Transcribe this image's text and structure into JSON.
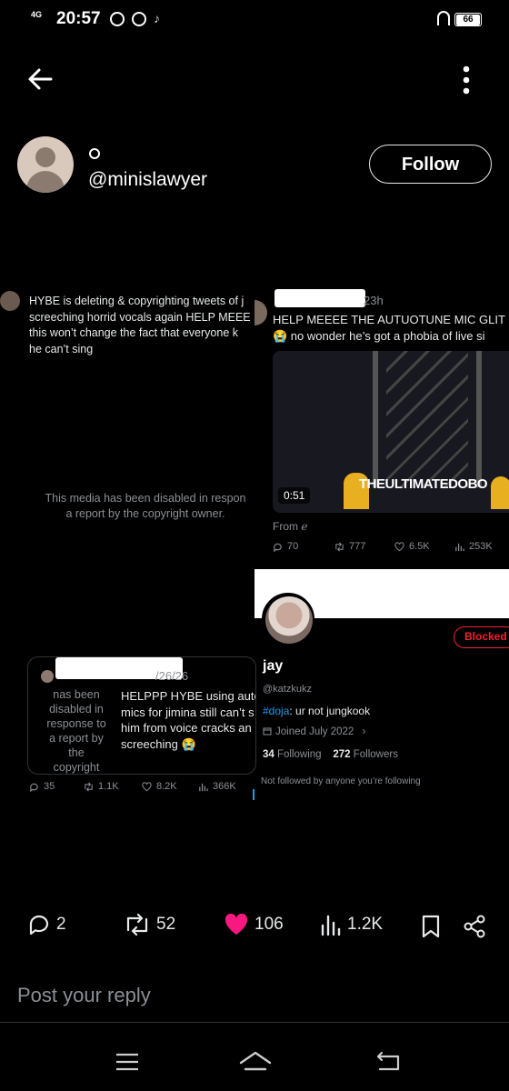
{
  "status_bar": {
    "network": "4G",
    "time": "20:57",
    "battery": "66"
  },
  "profile": {
    "handle": "@minislawyer",
    "follow_label": "Follow"
  },
  "embedded": {
    "tweet1": {
      "lines": [
        "HYBE is deleting & copyrighting tweets of j",
        "screeching horrid vocals again HELP MEEE",
        "this won’t change the fact that everyone k",
        "he can’t sing"
      ],
      "disabled_notice": [
        "This media has been disabled in respon",
        "a report by the copyright owner."
      ]
    },
    "tweet2": {
      "time": "23h",
      "line1": "HELP MEEEE THE AUTUOTUNE MIC GLIT",
      "line2": "😭 no wonder he’s got a phobia of live si",
      "video_duration": "0:51",
      "video_watermark": "THEULTIMATEDOBO",
      "from": "From ℯ",
      "replies": "70",
      "reposts": "777",
      "likes": "6.5K",
      "views": "253K"
    },
    "tweet3": {
      "time": "/26/26",
      "disabled_lines": [
        "nas been",
        "disabled in",
        "response to",
        "a report by",
        "the",
        "copyright"
      ],
      "lines": [
        "HELPPP HYBE using auto",
        "mics for jimina still can’t s",
        "him from voice cracks an",
        "screeching 😭"
      ],
      "replies": "35",
      "reposts": "1.1K",
      "likes": "8.2K",
      "views": "366K"
    },
    "account": {
      "name": "jay",
      "handle": "@katzkukz",
      "bio_tag": "#doja",
      "bio_rest": ": ur not jungkook",
      "joined": "Joined July 2022",
      "following_count": "34",
      "following_label": "Following",
      "followers_count": "272",
      "followers_label": "Followers",
      "not_followed": "Not followed by anyone you’re following",
      "blocked_label": "Blocked"
    }
  },
  "post_actions": {
    "replies": "2",
    "reposts": "52",
    "likes": "106",
    "views": "1.2K"
  },
  "reply": {
    "placeholder": "Post your reply"
  },
  "colors": {
    "background": "#000000",
    "like": "#f91880",
    "link": "#1d9bf0",
    "blocked": "#f4212e",
    "muted": "#8b8f94"
  }
}
